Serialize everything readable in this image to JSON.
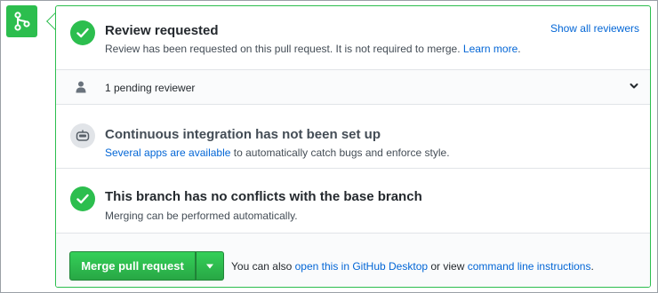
{
  "review": {
    "title": "Review requested",
    "description": "Review has been requested on this pull request. It is not required to merge.",
    "learn_more": "Learn more",
    "period": ".",
    "show_all": "Show all reviewers"
  },
  "pending": {
    "label": "1 pending reviewer"
  },
  "ci": {
    "title": "Continuous integration has not been set up",
    "link_text": "Several apps are available",
    "rest": " to automatically catch bugs and enforce style."
  },
  "conflicts": {
    "title": "This branch has no conflicts with the base branch",
    "description": "Merging can be performed automatically."
  },
  "merge": {
    "button_label": "Merge pull request",
    "hint_prefix": "You can also ",
    "desktop_link": "open this in GitHub Desktop",
    "hint_middle": " or view ",
    "cli_link": "command line instructions",
    "hint_suffix": "."
  },
  "colors": {
    "accent_green": "#2cbe4e",
    "link_blue": "#0366d6"
  },
  "icons": {
    "badge": "git-merge-icon",
    "review": "check-icon",
    "pending": "person-icon",
    "expand": "chevron-down-icon",
    "ci": "robot-icon",
    "conflicts": "check-icon",
    "merge_caret": "triangle-down-icon"
  }
}
